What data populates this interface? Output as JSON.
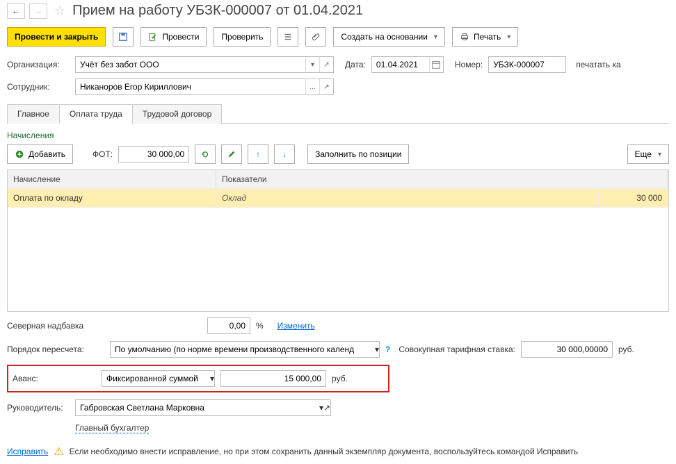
{
  "title": "Прием на работу УБЗК-000007 от 01.04.2021",
  "toolbar": {
    "post_close": "Провести и закрыть",
    "post": "Провести",
    "check": "Проверить",
    "create_based": "Создать на основании",
    "print": "Печать"
  },
  "form": {
    "org_label": "Организация:",
    "org_value": "Учёт без забот ООО",
    "date_label": "Дата:",
    "date_value": "01.04.2021",
    "number_label": "Номер:",
    "number_value": "УБЗК-000007",
    "print_qty_label": "печатать ка",
    "employee_label": "Сотрудник:",
    "employee_value": "Никаноров Егор Кириллович"
  },
  "tabs": {
    "t1": "Главное",
    "t2": "Оплата труда",
    "t3": "Трудовой договор"
  },
  "accruals": {
    "section": "Начисления",
    "add": "Добавить",
    "fot_label": "ФОТ:",
    "fot_value": "30 000,00",
    "fill_by_position": "Заполнить по позиции",
    "more": "Еще",
    "col1": "Начисление",
    "col2": "Показатели",
    "row_name": "Оплата по окладу",
    "row_indicator": "Оклад",
    "row_value": "30 000"
  },
  "north": {
    "label": "Северная надбавка",
    "value": "0,00",
    "pct": "%",
    "change": "Изменить"
  },
  "recalc": {
    "label": "Порядок пересчета:",
    "value": "По умолчанию (по норме времени производственного календ",
    "aggregate_label": "Совокупная тарифная ставка:",
    "aggregate_value": "30 000,00000",
    "rub": "руб."
  },
  "advance": {
    "label": "Аванс:",
    "method": "Фиксированной суммой",
    "amount": "15 000,00",
    "rub": "руб."
  },
  "manager": {
    "label": "Руководитель:",
    "value": "Габровская Светлана Марковна",
    "position": "Главный бухгалтер"
  },
  "footer": {
    "fix": "Исправить",
    "hint": "Если необходимо внести исправление, но при этом сохранить данный экземпляр документа, воспользуйтесь командой Исправить"
  }
}
